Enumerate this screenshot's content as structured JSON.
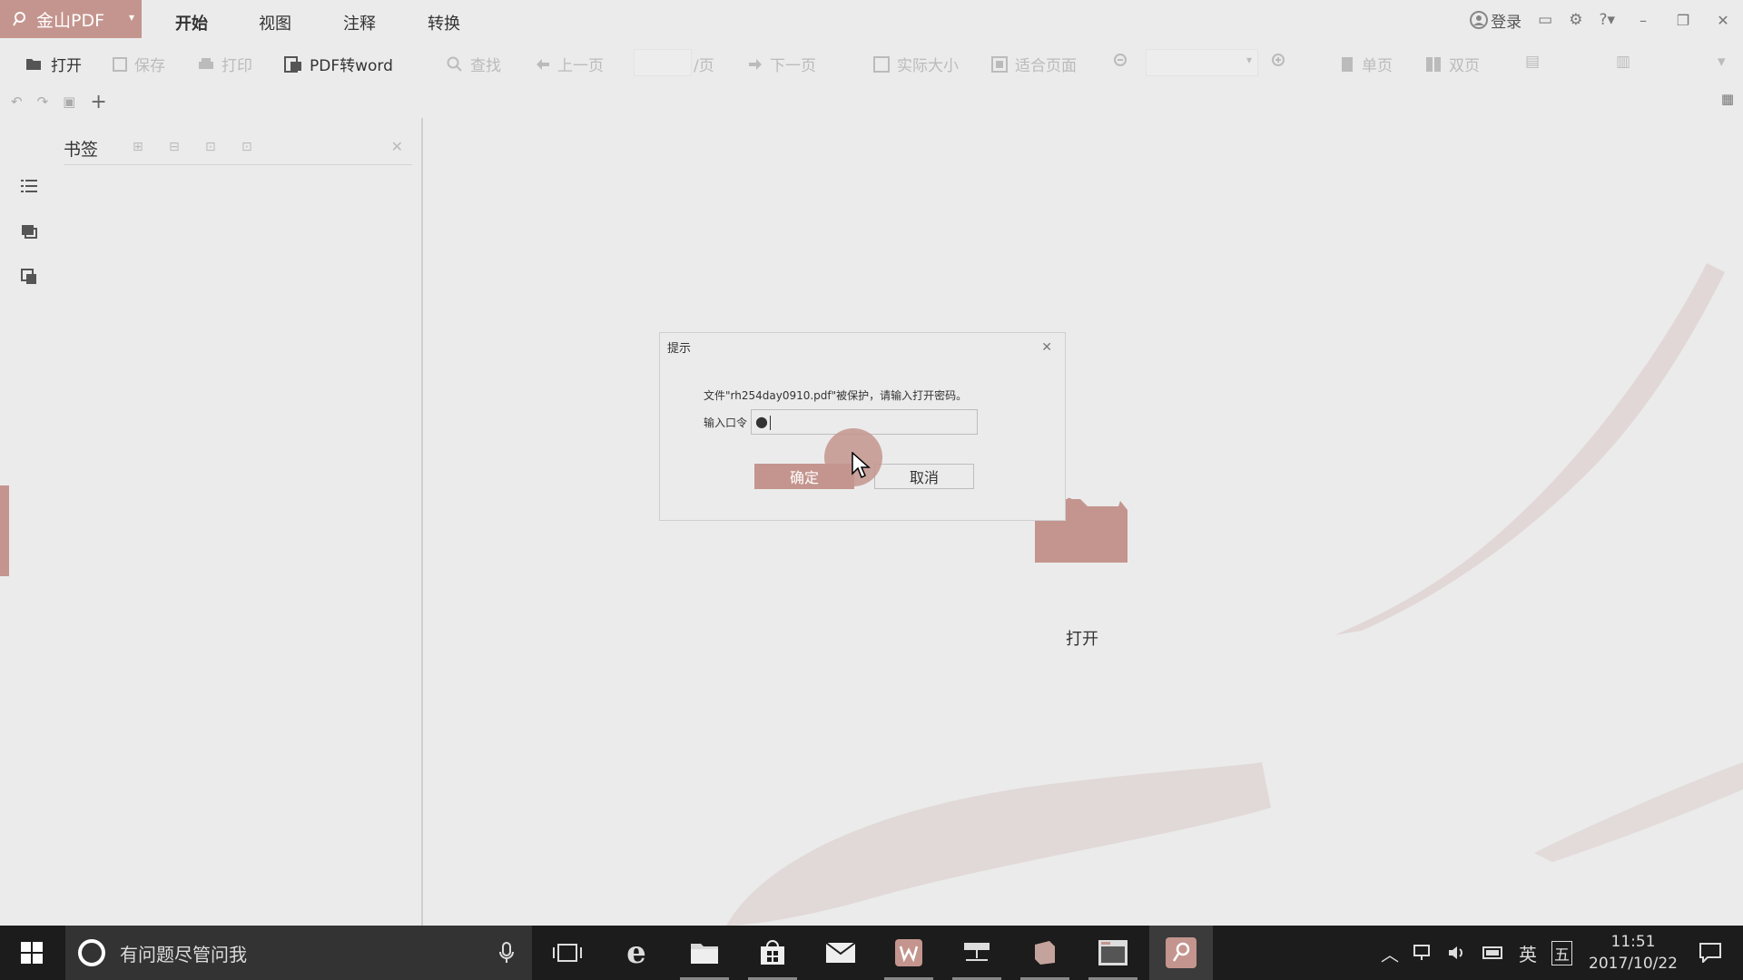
{
  "app": {
    "name": "金山PDF",
    "menu_tabs": [
      "开始",
      "视图",
      "注释",
      "转换"
    ],
    "login_label": "登录"
  },
  "toolbar": {
    "open": "打开",
    "save": "保存",
    "print": "打印",
    "pdf_to_word": "PDF转word",
    "find": "查找",
    "prev_page": "上一页",
    "page_suffix": "/页",
    "next_page": "下一页",
    "actual_size": "实际大小",
    "fit_page": "适合页面",
    "single_page": "单页",
    "double_page": "双页"
  },
  "bookmark_panel": {
    "title": "书签"
  },
  "main": {
    "open_label": "打开"
  },
  "dialog": {
    "title": "提示",
    "message": "文件\"rh254day0910.pdf\"被保护，请输入打开密码。",
    "password_label": "输入口令",
    "password_value": "●",
    "ok_label": "确定",
    "cancel_label": "取消"
  },
  "taskbar": {
    "search_placeholder": "有问题尽管问我",
    "ime_lang": "英",
    "ime_mode": "五",
    "time": "11:51",
    "date": "2017/10/22"
  },
  "colors": {
    "accent": "#c4958e",
    "background": "#ebebeb",
    "taskbar": "#1c1c1c"
  }
}
